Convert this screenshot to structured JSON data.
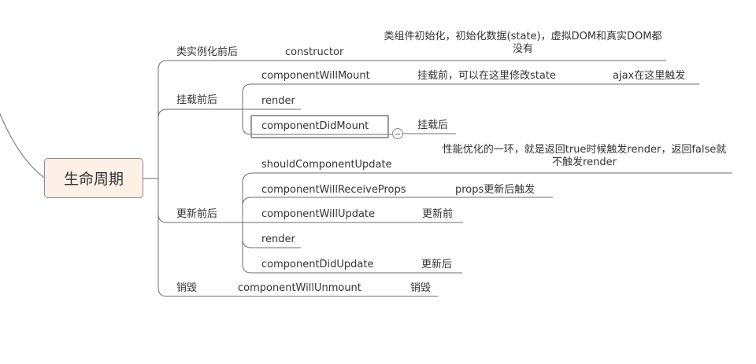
{
  "mindmap": {
    "root": "生命周期",
    "branches": [
      {
        "label": "类实例化前后",
        "children": [
          {
            "label": "constructor",
            "notes": [
              "类组件初始化，初始化数据(state)，虚拟DOM和真实DOM都没有"
            ]
          }
        ]
      },
      {
        "label": "挂载前后",
        "children": [
          {
            "label": "componentWillMount",
            "notes": [
              "挂载前，可以在这里修改state",
              "ajax在这里触发"
            ]
          },
          {
            "label": "render",
            "notes": []
          },
          {
            "label": "componentDidMount",
            "notes": [
              "挂载后"
            ],
            "selected": true,
            "collapsible": true
          }
        ]
      },
      {
        "label": "更新前后",
        "children": [
          {
            "label": "shouldComponentUpdate",
            "notes": [
              "性能优化的一环，就是返回true时候触发render，返回false就不触发render"
            ]
          },
          {
            "label": "componentWillReceiveProps",
            "notes": [
              "props更新后触发"
            ]
          },
          {
            "label": "componentWillUpdate",
            "notes": [
              "更新前"
            ]
          },
          {
            "label": "render",
            "notes": []
          },
          {
            "label": "componentDidUpdate",
            "notes": [
              "更新后"
            ]
          }
        ]
      },
      {
        "label": "销毁",
        "children": [
          {
            "label": "componentWillUnmount",
            "notes": [
              "销毁"
            ]
          }
        ]
      }
    ],
    "colors": {
      "line": "#6e6e6e",
      "root_fill": "#fdf0e6",
      "root_border": "#8a8a8a",
      "selection_border": "#9a9a9a",
      "text": "#333333"
    },
    "icons": [
      "collapse-icon"
    ]
  }
}
